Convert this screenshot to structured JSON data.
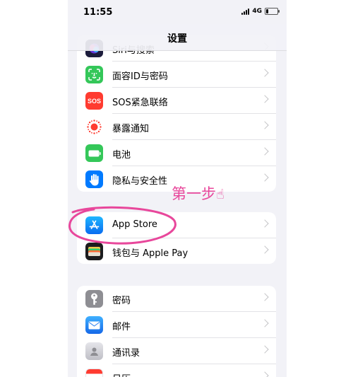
{
  "status_bar": {
    "time": "11:55",
    "network": "4G"
  },
  "nav": {
    "title": "设置"
  },
  "group1": {
    "items": [
      {
        "label": "Siri与搜索",
        "icon": "siri-icon",
        "color": "#1c1c3c"
      },
      {
        "label": "面容ID与密码",
        "icon": "face-id-icon",
        "color": "#34c759"
      },
      {
        "label": "SOS紧急联络",
        "icon": "sos-icon",
        "color": "#ff3b30",
        "icon_text": "SOS"
      },
      {
        "label": "暴露通知",
        "icon": "exposure-icon",
        "color": "#ffffff"
      },
      {
        "label": "电池",
        "icon": "battery-icon",
        "color": "#34c759"
      },
      {
        "label": "隐私与安全性",
        "icon": "hand-icon",
        "color": "#007aff"
      }
    ]
  },
  "group2": {
    "items": [
      {
        "label": "App Store",
        "icon": "app-store-icon",
        "color": "#1a8cff"
      },
      {
        "label": "钱包与 Apple Pay",
        "icon": "wallet-icon",
        "color": "#1c1c1e"
      }
    ]
  },
  "group3": {
    "items": [
      {
        "label": "密码",
        "icon": "key-icon",
        "color": "#8e8e93"
      },
      {
        "label": "邮件",
        "icon": "mail-icon",
        "color": "#1e90ff"
      },
      {
        "label": "通讯录",
        "icon": "contacts-icon",
        "color": "#c7c7cc"
      },
      {
        "label": "日历",
        "icon": "calendar-icon",
        "color": "#ffffff"
      }
    ]
  },
  "annotation": {
    "text": "第一步",
    "emoji": "☝",
    "color": "#e8479b"
  }
}
